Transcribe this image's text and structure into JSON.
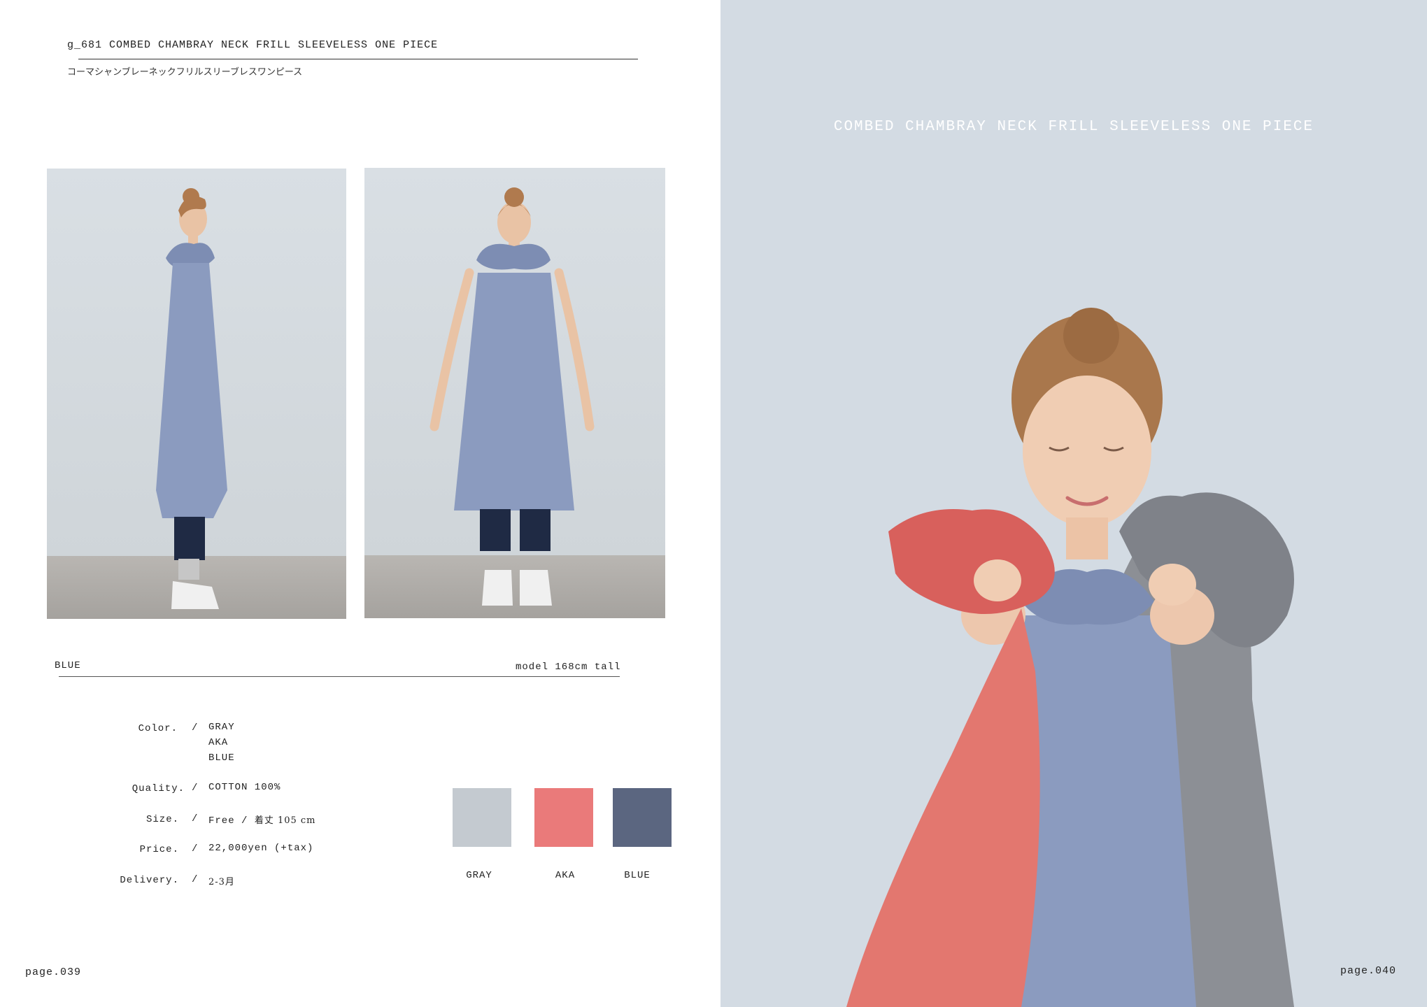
{
  "product": {
    "title": "g_681 COMBED CHAMBRAY NECK FRILL SLEEVELESS ONE PIECE",
    "subtitle_jp": "コーマシャンブレーネックフリルスリーブレスワンピース"
  },
  "photo_caption": {
    "color": "BLUE",
    "model": "model 168cm tall"
  },
  "specs": {
    "color_label": "Color.",
    "colors": [
      "GRAY",
      "AKA",
      "BLUE"
    ],
    "quality_label": "Quality.",
    "quality": "COTTON 100%",
    "size_label": "Size.",
    "size_free": "Free",
    "size_length": "着丈 105 cm",
    "price_label": "Price.",
    "price": "22,000yen (+tax)",
    "delivery_label": "Delivery.",
    "delivery": "2-3月",
    "separator": "/"
  },
  "swatches": [
    {
      "label": "GRAY",
      "color": "#c4cad0"
    },
    {
      "label": "AKA",
      "color": "#ea7a7a"
    },
    {
      "label": "BLUE",
      "color": "#5b6680"
    }
  ],
  "hero": {
    "title": "COMBED CHAMBRAY NECK FRILL SLEEVELESS ONE PIECE"
  },
  "pages": {
    "left": "page.039",
    "right": "page.040"
  },
  "colors": {
    "dress_blue": "#8b9bbf",
    "hero_bg": "#d3dbe3",
    "rule": "#333333"
  }
}
